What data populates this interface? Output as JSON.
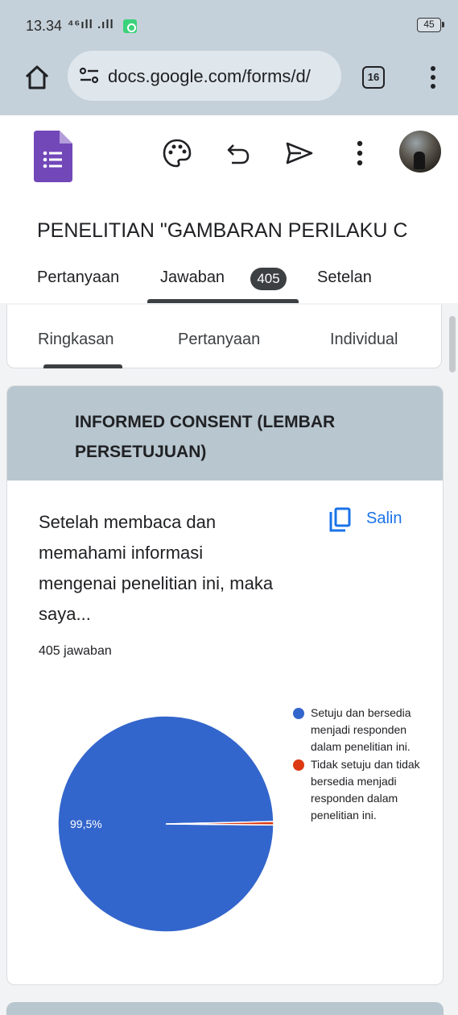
{
  "status_bar": {
    "time": "13.34",
    "signal": "⁴⁶ıll .ıll",
    "battery": "45"
  },
  "browser": {
    "url": "docs.google.com/forms/d/",
    "tab_count": "16",
    "icons": [
      "home-icon",
      "site-settings-icon",
      "tabs-icon",
      "more-vert-icon"
    ]
  },
  "forms_header": {
    "icons": [
      "google-forms-logo",
      "palette-icon",
      "undo-icon",
      "send-icon",
      "more-vert-icon",
      "avatar"
    ]
  },
  "form": {
    "title": "PENELITIAN \"GAMBARAN PERILAKU C"
  },
  "main_tabs": {
    "questions": "Pertanyaan",
    "responses": "Jawaban",
    "responses_badge": "405",
    "settings": "Setelan",
    "active": "Jawaban"
  },
  "sub_tabs": {
    "summary": "Ringkasan",
    "question": "Pertanyaan",
    "individual": "Individual",
    "active": "Ringkasan"
  },
  "section": {
    "title": "INFORMED CONSENT (LEMBAR PERSETUJUAN)"
  },
  "question_card": {
    "question_text": "Setelah membaca dan memahami informasi mengenai penelitian ini, maka saya...",
    "copy_label": "Salin",
    "response_count": "405 jawaban"
  },
  "colors": {
    "accent": "#1a73e8",
    "header_bg": "#b8c6cf",
    "slice_agree": "#3366cc",
    "slice_disagree": "#dc3912"
  },
  "chart_data": {
    "type": "pie",
    "labels": [
      "Setuju dan bersedia menjadi responden dalam penelitian ini.",
      "Tidak setuju dan tidak bersedia menjadi responden dalam penelitian ini."
    ],
    "values": [
      99.5,
      0.5
    ],
    "data_labels": [
      "99,5%",
      ""
    ],
    "colors": [
      "#3366cc",
      "#dc3912"
    ],
    "legend_position": "right"
  }
}
